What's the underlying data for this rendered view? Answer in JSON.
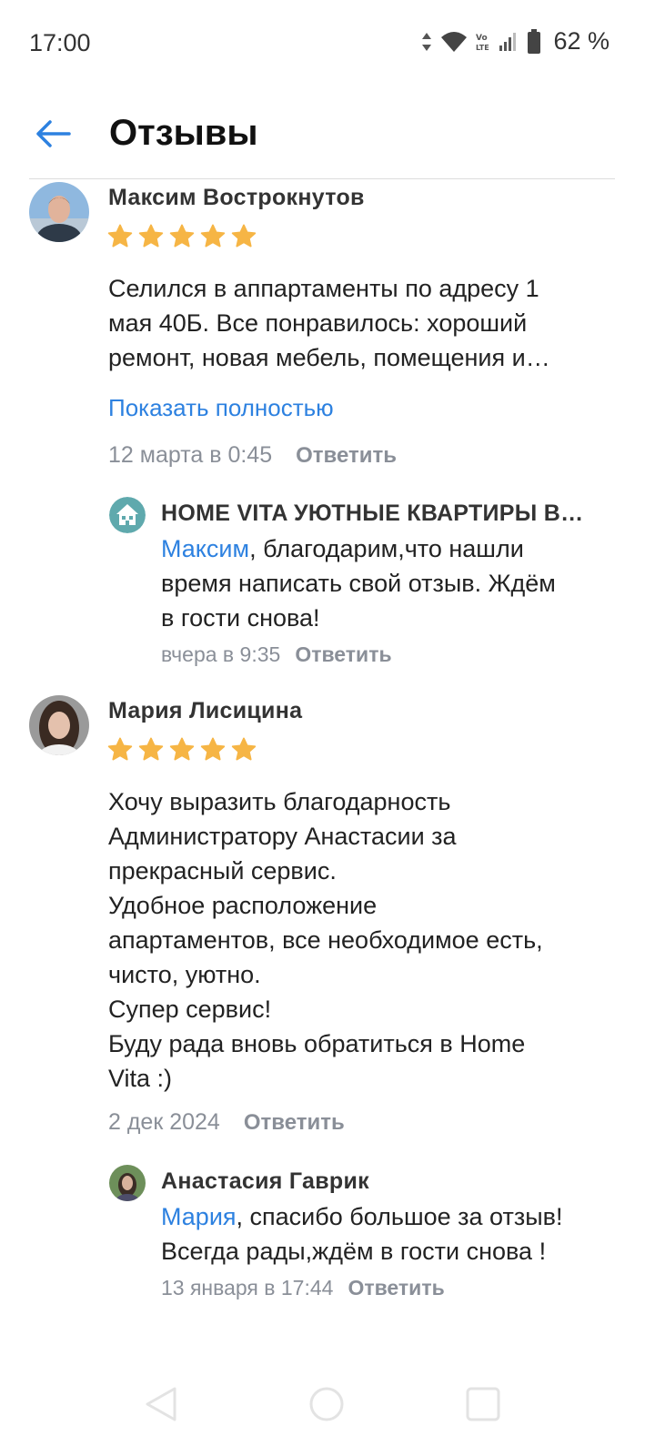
{
  "status": {
    "time": "17:00",
    "network": "Vo LTE",
    "battery": "62 %"
  },
  "header": {
    "title": "Отзывы",
    "back_icon": "arrow-left-icon"
  },
  "reviews": [
    {
      "author": "Максим Вострокнутов",
      "rating": 5,
      "text_lines": [
        "Селился в аппартаменты по адресу 1",
        "мая 40Б. Все понравилось: хороший",
        "ремонт, новая мебель, помещения и…"
      ],
      "show_more": "Показать полностью",
      "date": "12 марта в 0:45",
      "reply_label": "Ответить",
      "response": {
        "author": "HOME VITA УЮТНЫЕ КВАРТИРЫ  В…",
        "mention": "Максим",
        "text_first": ", благодарим,что нашли",
        "text_lines": [
          "время написать свой отзыв. Ждём",
          "в гости снова!"
        ],
        "date": "вчера в 9:35",
        "reply_label": "Ответить"
      }
    },
    {
      "author": "Мария Лисицина",
      "rating": 5,
      "text_lines": [
        "Хочу выразить благодарность",
        "Администратору Анастасии за",
        "прекрасный сервис.",
        "Удобное расположение",
        "апартаментов, все необходимое есть,",
        "чисто, уютно.",
        "Супер сервис!",
        "Буду рада вновь обратиться в Home",
        "Vita :)"
      ],
      "date": "2 дек 2024",
      "reply_label": "Ответить",
      "response": {
        "author": "Анастасия Гаврик",
        "mention": "Мария",
        "text_first": ", спасибо большое за отзыв!",
        "text_lines": [
          "Всегда рады,ждём в гости снова !"
        ],
        "date": "13 января в 17:44",
        "reply_label": "Ответить"
      }
    }
  ],
  "colors": {
    "accent": "#2d81e0",
    "star": "#f6b545",
    "meta": "#8a8f98"
  }
}
